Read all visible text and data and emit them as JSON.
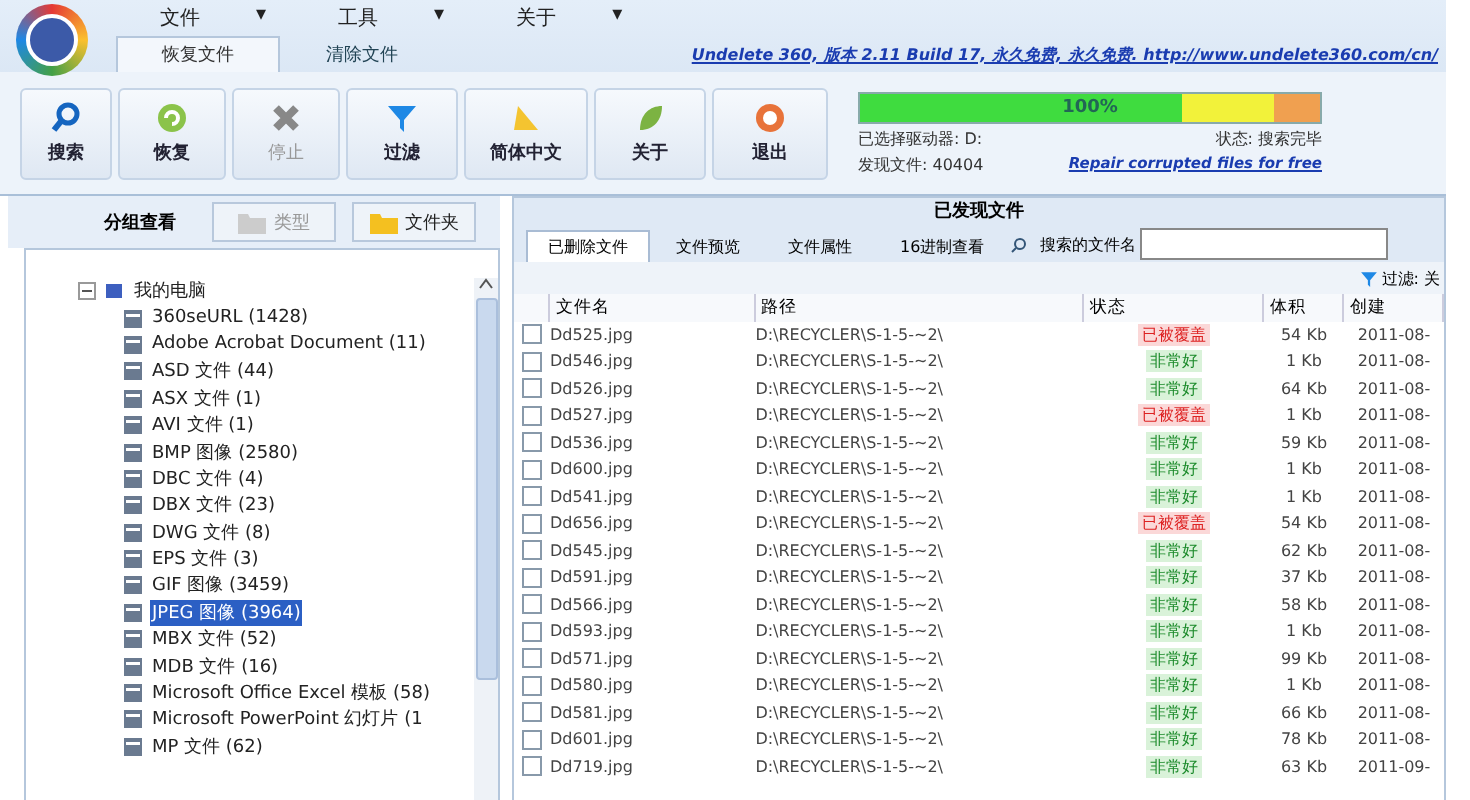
{
  "menu": [
    {
      "label": "文件",
      "caret": "▾"
    },
    {
      "label": "工具",
      "caret": "▾"
    },
    {
      "label": "关于",
      "caret": "▾"
    }
  ],
  "ribbon_tabs": [
    {
      "label": "恢复文件",
      "selected": true
    },
    {
      "label": "清除文件",
      "selected": false
    }
  ],
  "header_link": "Undelete 360, 版本 2.11 Build 17, 永久免费, 永久免费. http://www.undelete360.com/cn/",
  "toolbar": [
    {
      "kind": "search",
      "label": "搜索",
      "disabled": false
    },
    {
      "kind": "recover",
      "label": "恢复",
      "disabled": false
    },
    {
      "kind": "stop",
      "label": "停止",
      "disabled": true
    },
    {
      "kind": "filter",
      "label": "过滤",
      "disabled": false
    },
    {
      "kind": "language",
      "label": "简体中文",
      "disabled": false
    },
    {
      "kind": "about",
      "label": "关于",
      "disabled": false
    },
    {
      "kind": "exit",
      "label": "退出",
      "disabled": false
    }
  ],
  "progress": {
    "level": 1,
    "reading": "100%"
  },
  "drive": "已选择驱动器: D:",
  "found": "发现文件: 40404",
  "status": "状态: 搜索完毕",
  "repair_link": "Repair corrupted files for free",
  "sidebar": {
    "title": "分组查看",
    "buttons": [
      {
        "label": "类型",
        "selected": false
      },
      {
        "label": "文件夹",
        "selected": true
      }
    ],
    "tree": [
      {
        "label": "我的电脑",
        "expanded": true,
        "children": [
          {
            "label": "360seURL (1428)",
            "selected": false
          },
          {
            "label": "Adobe Acrobat Document (11)",
            "selected": false
          },
          {
            "label": "ASD 文件 (44)",
            "selected": false
          },
          {
            "label": "ASX 文件 (1)",
            "selected": false
          },
          {
            "label": "AVI 文件 (1)",
            "selected": false
          },
          {
            "label": "BMP 图像 (2580)",
            "selected": false
          },
          {
            "label": "DBC 文件 (4)",
            "selected": false
          },
          {
            "label": "DBX 文件 (23)",
            "selected": false
          },
          {
            "label": "DWG 文件 (8)",
            "selected": false
          },
          {
            "label": "EPS 文件 (3)",
            "selected": false
          },
          {
            "label": "GIF 图像 (3459)",
            "selected": false
          },
          {
            "label": "JPEG 图像 (3964)",
            "selected": true
          },
          {
            "label": "MBX 文件 (52)",
            "selected": false
          },
          {
            "label": "MDB 文件 (16)",
            "selected": false
          },
          {
            "label": "Microsoft Office Excel 模板 (58)",
            "selected": false
          },
          {
            "label": "Microsoft PowerPoint 幻灯片 (1",
            "selected": false
          },
          {
            "label": "MP 文件 (62)",
            "selected": false
          }
        ]
      }
    ]
  },
  "panel": {
    "title": "已发现文件",
    "tabs": [
      {
        "label": "已删除文件",
        "selected": true
      },
      {
        "label": "文件预览",
        "selected": false
      },
      {
        "label": "文件属性",
        "selected": false
      },
      {
        "label": "16进制查看",
        "selected": false
      }
    ],
    "search_label": "搜索的文件名",
    "filter": "过滤: 关"
  },
  "table": {
    "columns": [
      "文件名",
      "路径",
      "状态",
      "体积",
      "创建"
    ],
    "rows": [
      {
        "name": "Dd525.jpg",
        "path": "D:\\RECYCLER\\S-1-5-~2\\",
        "kind": "overwritten",
        "status": "已被覆盖",
        "size": "54 Kb",
        "created": "2011-08-",
        "checked": false
      },
      {
        "name": "Dd546.jpg",
        "path": "D:\\RECYCLER\\S-1-5-~2\\",
        "kind": "good",
        "status": "非常好",
        "size": "1 Kb",
        "created": "2011-08-",
        "checked": false
      },
      {
        "name": "Dd526.jpg",
        "path": "D:\\RECYCLER\\S-1-5-~2\\",
        "kind": "good",
        "status": "非常好",
        "size": "64 Kb",
        "created": "2011-08-",
        "checked": false
      },
      {
        "name": "Dd527.jpg",
        "path": "D:\\RECYCLER\\S-1-5-~2\\",
        "kind": "overwritten",
        "status": "已被覆盖",
        "size": "1 Kb",
        "created": "2011-08-",
        "checked": false
      },
      {
        "name": "Dd536.jpg",
        "path": "D:\\RECYCLER\\S-1-5-~2\\",
        "kind": "good",
        "status": "非常好",
        "size": "59 Kb",
        "created": "2011-08-",
        "checked": false
      },
      {
        "name": "Dd600.jpg",
        "path": "D:\\RECYCLER\\S-1-5-~2\\",
        "kind": "good",
        "status": "非常好",
        "size": "1 Kb",
        "created": "2011-08-",
        "checked": false
      },
      {
        "name": "Dd541.jpg",
        "path": "D:\\RECYCLER\\S-1-5-~2\\",
        "kind": "good",
        "status": "非常好",
        "size": "1 Kb",
        "created": "2011-08-",
        "checked": false
      },
      {
        "name": "Dd656.jpg",
        "path": "D:\\RECYCLER\\S-1-5-~2\\",
        "kind": "overwritten",
        "status": "已被覆盖",
        "size": "54 Kb",
        "created": "2011-08-",
        "checked": false
      },
      {
        "name": "Dd545.jpg",
        "path": "D:\\RECYCLER\\S-1-5-~2\\",
        "kind": "good",
        "status": "非常好",
        "size": "62 Kb",
        "created": "2011-08-",
        "checked": false
      },
      {
        "name": "Dd591.jpg",
        "path": "D:\\RECYCLER\\S-1-5-~2\\",
        "kind": "good",
        "status": "非常好",
        "size": "37 Kb",
        "created": "2011-08-",
        "checked": false
      },
      {
        "name": "Dd566.jpg",
        "path": "D:\\RECYCLER\\S-1-5-~2\\",
        "kind": "good",
        "status": "非常好",
        "size": "58 Kb",
        "created": "2011-08-",
        "checked": false
      },
      {
        "name": "Dd593.jpg",
        "path": "D:\\RECYCLER\\S-1-5-~2\\",
        "kind": "good",
        "status": "非常好",
        "size": "1 Kb",
        "created": "2011-08-",
        "checked": false
      },
      {
        "name": "Dd571.jpg",
        "path": "D:\\RECYCLER\\S-1-5-~2\\",
        "kind": "good",
        "status": "非常好",
        "size": "99 Kb",
        "created": "2011-08-",
        "checked": false
      },
      {
        "name": "Dd580.jpg",
        "path": "D:\\RECYCLER\\S-1-5-~2\\",
        "kind": "good",
        "status": "非常好",
        "size": "1 Kb",
        "created": "2011-08-",
        "checked": false
      },
      {
        "name": "Dd581.jpg",
        "path": "D:\\RECYCLER\\S-1-5-~2\\",
        "kind": "good",
        "status": "非常好",
        "size": "66 Kb",
        "created": "2011-08-",
        "checked": false
      },
      {
        "name": "Dd601.jpg",
        "path": "D:\\RECYCLER\\S-1-5-~2\\",
        "kind": "good",
        "status": "非常好",
        "size": "78 Kb",
        "created": "2011-08-",
        "checked": false
      },
      {
        "name": "Dd719.jpg",
        "path": "D:\\RECYCLER\\S-1-5-~2\\",
        "kind": "good",
        "status": "非常好",
        "size": "63 Kb",
        "created": "2011-09-",
        "checked": false
      }
    ]
  }
}
